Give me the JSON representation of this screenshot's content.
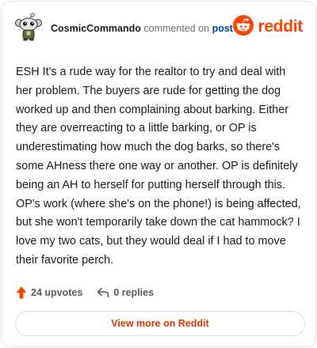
{
  "header": {
    "username": "CosmicCommando",
    "verb": "commented on",
    "post_link": "post",
    "brand": "reddit"
  },
  "comment": {
    "text": "ESH It's a rude way for the realtor to try and deal with her problem. The buyers are rude for getting the dog worked up and then complaining about barking. Either they are overreacting to a little barking, or OP is underestimating how much the dog barks, so there's some AHness there one way or another. OP is definitely being an AH to herself for putting herself through this. OP's work (where she's on the phone!) is being affected, but she won't temporarily take down the cat hammock? I love my two cats, but they would deal if I had to move their favorite perch."
  },
  "stats": {
    "upvotes": "24 upvotes",
    "replies": "0 replies"
  },
  "actions": {
    "view_more": "View more on Reddit"
  },
  "colors": {
    "brand": "#ff4500",
    "link": "#0045ac",
    "view_more": "#d93a00"
  },
  "icons": {
    "avatar": "snoo-avatar-icon",
    "logo": "reddit-logo-icon",
    "upvote": "upvote-arrow-icon",
    "reply": "reply-arrow-icon"
  }
}
